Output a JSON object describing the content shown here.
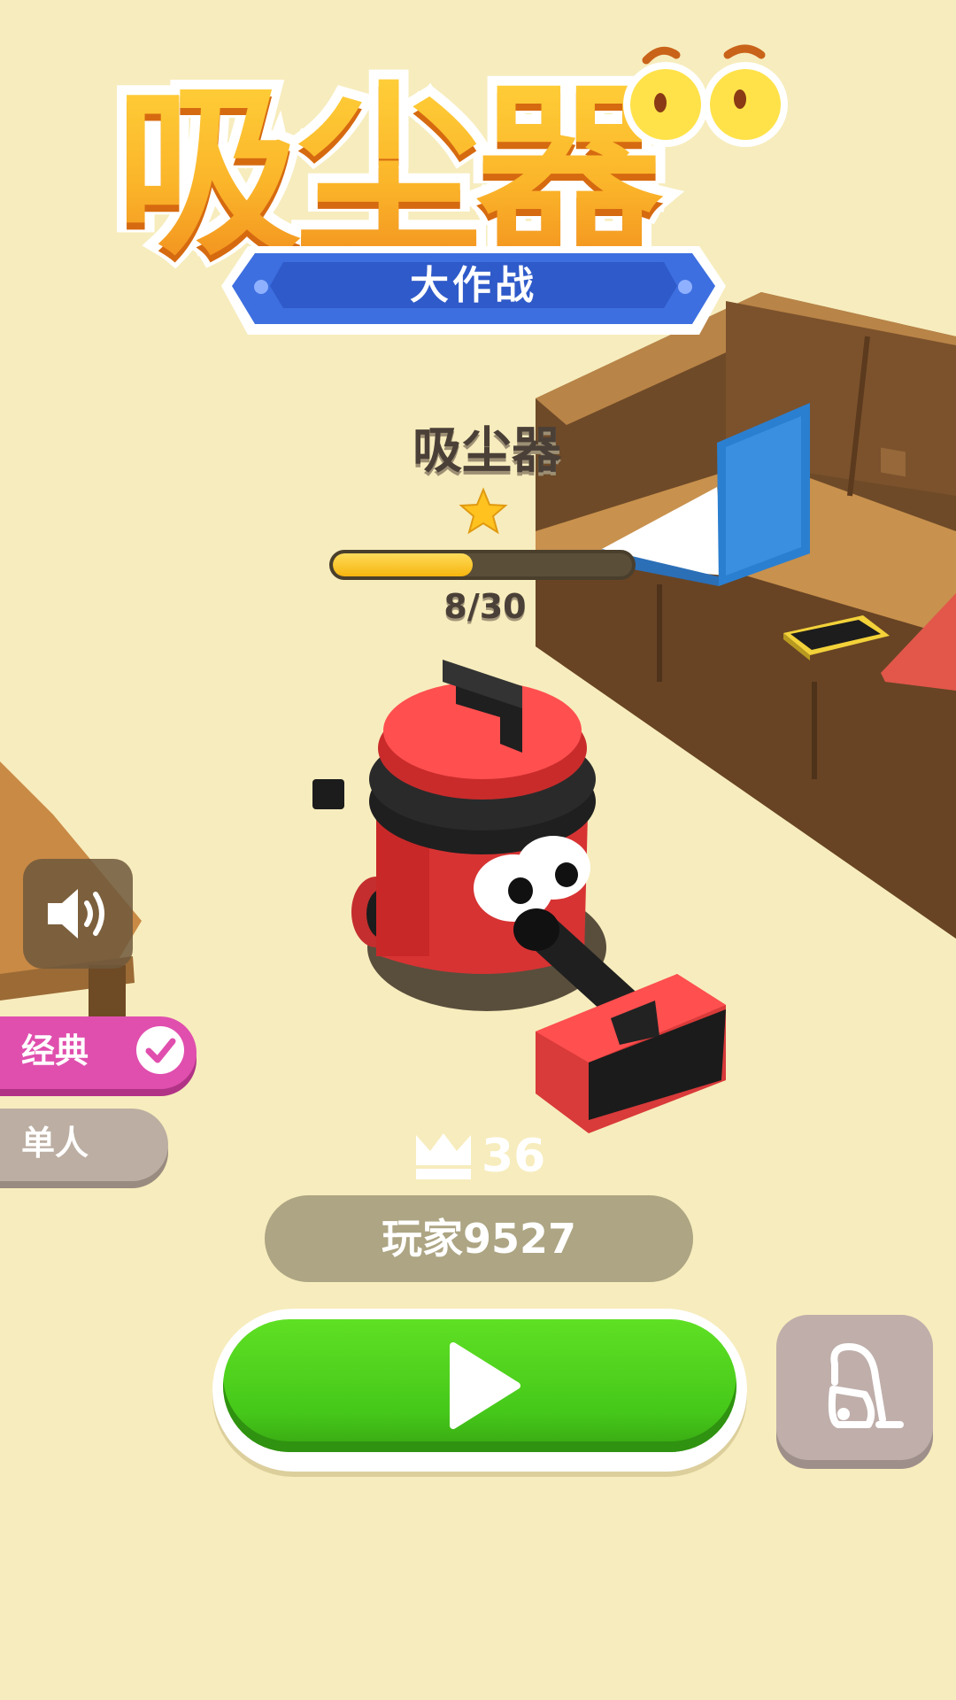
{
  "logo": {
    "title": "吸尘器",
    "subtitle": "大作战"
  },
  "skin": {
    "name": "吸尘器",
    "stars": 1,
    "progress_text": "8/30",
    "progress_fraction": 0.4667
  },
  "modes": {
    "classic_label": "经典",
    "classic_selected": true,
    "solo_label": "单人"
  },
  "player": {
    "crown_score": "36",
    "name": "玩家9527"
  },
  "icons": {
    "sound": "speaker-icon",
    "check": "check-icon",
    "crown": "crown-icon",
    "play": "play-icon",
    "vacuum": "vacuum-icon",
    "star": "star-icon"
  },
  "colors": {
    "background": "#f7ecbd",
    "play_green": "#46c81a",
    "classic_pink": "#e04fae",
    "progress_yellow": "#f6b50e",
    "player_pill": "#ada583"
  }
}
